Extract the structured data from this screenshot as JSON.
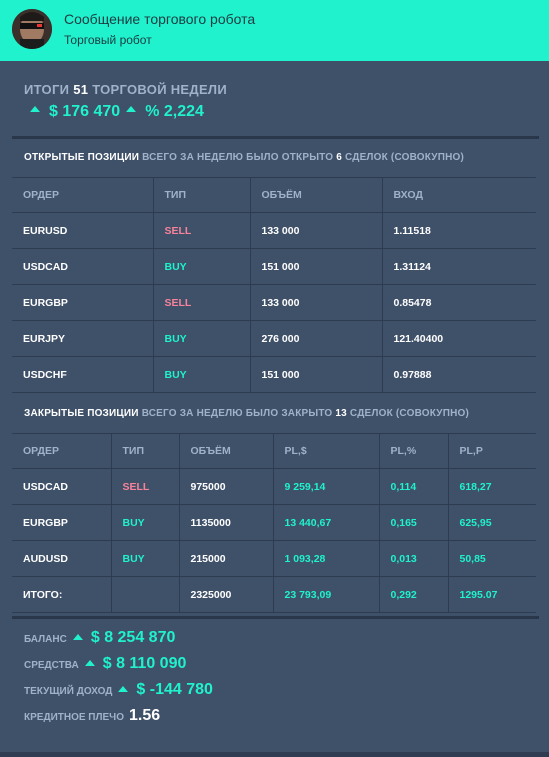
{
  "header": {
    "title": "Сообщение торгового робота",
    "subtitle": "Торговый робот"
  },
  "week": {
    "prefix": "ИТОГИ",
    "number": "51",
    "suffix": "ТОРГОВОЙ НЕДЕЛИ",
    "profit": "$ 176 470",
    "percent": "% 2,224"
  },
  "open_positions": {
    "title": "ОТКРЫТЫЕ ПОЗИЦИИ",
    "desc_before": "ВСЕГО ЗА НЕДЕЛЮ БЫЛО ОТКРЫТО",
    "count": "6",
    "desc_after": "СДЕЛОК (СОВОКУПНО)",
    "columns": [
      "ОРДЕР",
      "ТИП",
      "ОБЪЁМ",
      "ВХОД"
    ],
    "rows": [
      {
        "order": "EURUSD",
        "type": "SELL",
        "volume": "133 000",
        "entry": "1.11518"
      },
      {
        "order": "USDCAD",
        "type": "BUY",
        "volume": "151 000",
        "entry": "1.31124"
      },
      {
        "order": "EURGBP",
        "type": "SELL",
        "volume": "133 000",
        "entry": "0.85478"
      },
      {
        "order": "EURJPY",
        "type": "BUY",
        "volume": "276 000",
        "entry": "121.40400"
      },
      {
        "order": "USDCHF",
        "type": "BUY",
        "volume": "151 000",
        "entry": "0.97888"
      }
    ]
  },
  "closed_positions": {
    "title": "ЗАКРЫТЫЕ ПОЗИЦИИ",
    "desc_before": "ВСЕГО ЗА НЕДЕЛЮ БЫЛО ЗАКРЫТО",
    "count": "13",
    "desc_after": "СДЕЛОК (СОВОКУПНО)",
    "columns": [
      "ОРДЕР",
      "ТИП",
      "ОБЪЁМ",
      "PL,$",
      "PL,%",
      "PL,P"
    ],
    "rows": [
      {
        "order": "USDCAD",
        "type": "SELL",
        "volume": "975000",
        "pl_usd": "9 259,14",
        "pl_pct": "0,114",
        "pl_p": "618,27"
      },
      {
        "order": "EURGBP",
        "type": "BUY",
        "volume": "1135000",
        "pl_usd": "13 440,67",
        "pl_pct": "0,165",
        "pl_p": "625,95"
      },
      {
        "order": "AUDUSD",
        "type": "BUY",
        "volume": "215000",
        "pl_usd": "1 093,28",
        "pl_pct": "0,013",
        "pl_p": "50,85"
      }
    ],
    "total": {
      "label": "ИТОГО:",
      "volume": "2325000",
      "pl_usd": "23 793,09",
      "pl_pct": "0,292",
      "pl_p": "1295.07"
    }
  },
  "account": {
    "balance_label": "БАЛАНС",
    "balance": "$ 8 254 870",
    "equity_label": "СРЕДСТВА",
    "equity": "$ 8 110 090",
    "income_label": "ТЕКУЩИЙ ДОХОД",
    "income": "$ -144 780",
    "leverage_label": "КРЕДИТНОЕ ПЛЕЧО",
    "leverage": "1.56"
  },
  "colors": {
    "accent": "#1ff2cd",
    "sell": "#f7839a",
    "background": "#3f5069"
  },
  "icons": {
    "avatar": "robot-avatar",
    "up": "triangle-up-icon"
  }
}
